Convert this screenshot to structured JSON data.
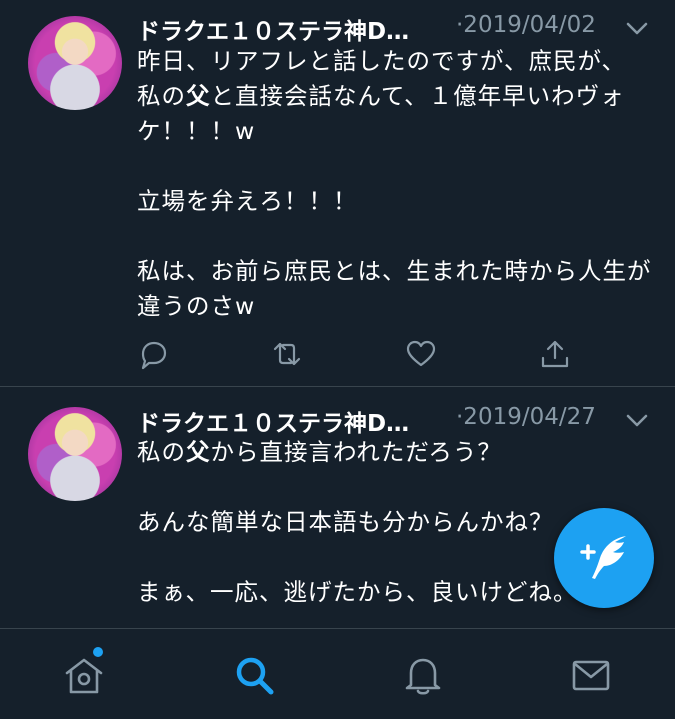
{
  "tweets": [
    {
      "author": "ドラクエ１０ステラ神D…",
      "date": "·2019/04/02",
      "text_before": "昨日、リアフレと話したのですが、庶民が、\n私の",
      "text_bold": "父",
      "text_after": "と直接会話なんて、１億年早いわヴォケ！！！w\n\n立場を弁えろ！！！\n\n私は、お前ら庶民とは、生まれた時から人生が違うのさw"
    },
    {
      "author": "ドラクエ１０ステラ神D…",
      "date": "·2019/04/27",
      "text_before": "私の",
      "text_bold": "父",
      "text_after": "から直接言われただろう？\n\nあんな簡単な日本語も分からんかね？\n\nまぁ、一応、逃げたから、良いけどね。"
    }
  ],
  "icons": {
    "reply": "reply-icon",
    "retweet": "retweet-icon",
    "like": "heart-icon",
    "share": "share-icon",
    "compose": "compose-tweet-icon",
    "home": "home-icon",
    "search": "search-icon",
    "notifications": "bell-icon",
    "messages": "mail-icon"
  },
  "colors": {
    "background": "#15202b",
    "accent": "#1da1f2",
    "muted": "#8899a6",
    "divider": "#38444d"
  }
}
